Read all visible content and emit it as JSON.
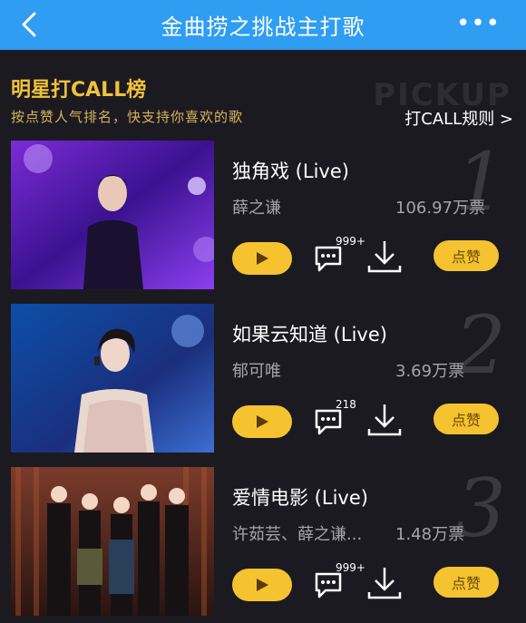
{
  "header": {
    "title": "金曲捞之挑战主打歌",
    "more": "•••"
  },
  "section": {
    "title": "明星打CALL榜",
    "subtitle": "按点赞人气排名，快支持你喜欢的歌",
    "watermark": "PICKUP",
    "rules_link": "打CALL规则 >"
  },
  "songs": [
    {
      "rank": "1",
      "title": "独角戏 (Live)",
      "artist": "薛之谦",
      "votes": "106.97万票",
      "comments": "999+",
      "like_label": "点赞"
    },
    {
      "rank": "2",
      "title": "如果云知道 (Live)",
      "artist": "郁可唯",
      "votes": "3.69万票",
      "comments": "218",
      "like_label": "点赞"
    },
    {
      "rank": "3",
      "title": "爱情电影 (Live)",
      "artist": "许茹芸、薛之谦...",
      "votes": "1.48万票",
      "comments": "999+",
      "like_label": "点赞"
    }
  ]
}
